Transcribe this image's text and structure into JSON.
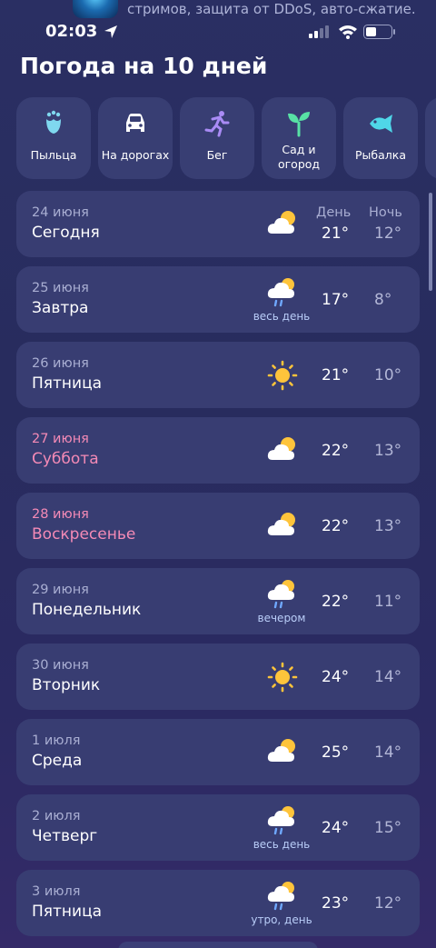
{
  "banner": {
    "text": "стримов, защита от DDoS, авто-сжатие."
  },
  "status": {
    "time": "02:03"
  },
  "page": {
    "title": "Погода на 10 дней"
  },
  "categories": [
    {
      "label": "Пыльца",
      "icon": "flower-icon"
    },
    {
      "label": "На дорогах",
      "icon": "car-icon"
    },
    {
      "label": "Бег",
      "icon": "running-icon"
    },
    {
      "label": "Сад и огород",
      "icon": "sprout-icon"
    },
    {
      "label": "Рыбалка",
      "icon": "fish-icon"
    }
  ],
  "forecast": {
    "header_day": "День",
    "header_night": "Ночь",
    "days": [
      {
        "date": "24 июня",
        "day": "Сегодня",
        "icon": "partly-cloudy",
        "note": "",
        "t_day": "21°",
        "t_night": "12°",
        "weekend": false
      },
      {
        "date": "25 июня",
        "day": "Завтра",
        "icon": "cloud-rain",
        "note": "весь день",
        "t_day": "17°",
        "t_night": "8°",
        "weekend": false
      },
      {
        "date": "26 июня",
        "day": "Пятница",
        "icon": "sunny",
        "note": "",
        "t_day": "21°",
        "t_night": "10°",
        "weekend": false
      },
      {
        "date": "27 июня",
        "day": "Суббота",
        "icon": "partly-cloudy",
        "note": "",
        "t_day": "22°",
        "t_night": "13°",
        "weekend": true
      },
      {
        "date": "28 июня",
        "day": "Воскресенье",
        "icon": "partly-cloudy",
        "note": "",
        "t_day": "22°",
        "t_night": "13°",
        "weekend": true
      },
      {
        "date": "29 июня",
        "day": "Понедельник",
        "icon": "cloud-rain",
        "note": "вечером",
        "t_day": "22°",
        "t_night": "11°",
        "weekend": false
      },
      {
        "date": "30 июня",
        "day": "Вторник",
        "icon": "sunny",
        "note": "",
        "t_day": "24°",
        "t_night": "14°",
        "weekend": false
      },
      {
        "date": "1 июля",
        "day": "Среда",
        "icon": "partly-cloudy",
        "note": "",
        "t_day": "25°",
        "t_night": "14°",
        "weekend": false
      },
      {
        "date": "2 июля",
        "day": "Четверг",
        "icon": "cloud-rain",
        "note": "весь день",
        "t_day": "24°",
        "t_night": "15°",
        "weekend": false
      },
      {
        "date": "3 июля",
        "day": "Пятница",
        "icon": "cloud-rain",
        "note": "утро, день",
        "t_day": "23°",
        "t_night": "12°",
        "weekend": false
      }
    ]
  },
  "colors": {
    "background": "#2a2f63",
    "card": "#383d72",
    "weekend": "#f48ab6",
    "accent": "#58e1c0"
  }
}
